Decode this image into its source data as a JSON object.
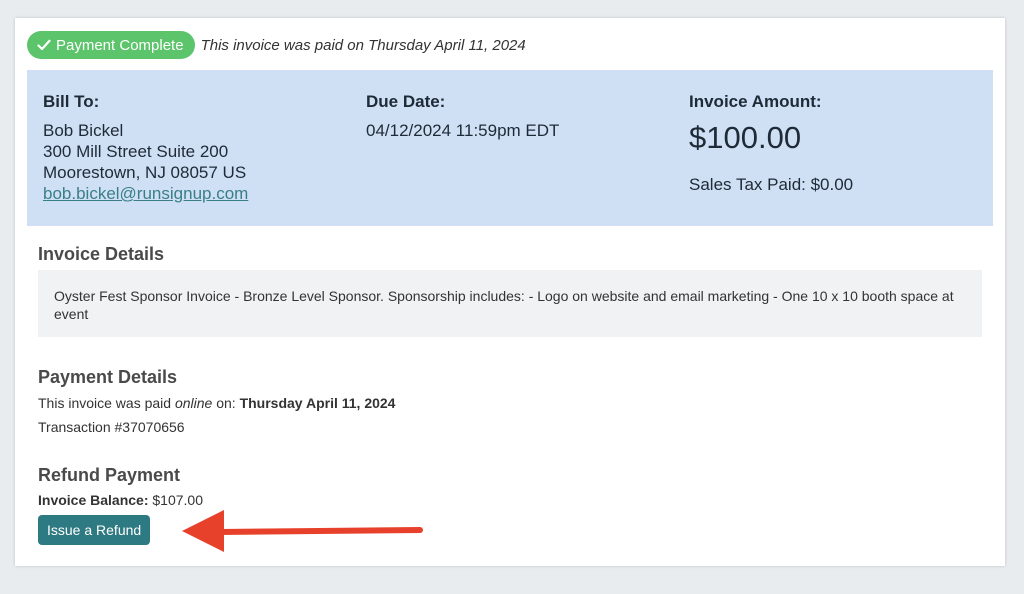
{
  "status": {
    "badge_label": "Payment Complete",
    "badge_icon": "check-icon",
    "badge_color": "#5cc46b",
    "paid_note": "This invoice was paid on Thursday April 11, 2024"
  },
  "bill_to": {
    "heading": "Bill To:",
    "name": "Bob Bickel",
    "address_line1": "300 Mill Street Suite 200",
    "address_line2": "Moorestown, NJ 08057 US",
    "email": "bob.bickel@runsignup.com"
  },
  "due_date": {
    "heading": "Due Date:",
    "value": "04/12/2024 11:59pm EDT"
  },
  "invoice_amount": {
    "heading": "Invoice Amount:",
    "value": "$100.00",
    "sales_tax": "Sales Tax Paid: $0.00"
  },
  "invoice_details": {
    "title": "Invoice Details",
    "description": "Oyster Fest Sponsor Invoice - Bronze Level Sponsor. Sponsorship includes: - Logo on website and email marketing - One 10 x 10 booth space at event"
  },
  "payment_details": {
    "title": "Payment Details",
    "paid_prefix": "This invoice was paid ",
    "paid_method": "online",
    "paid_on": " on: ",
    "paid_date": "Thursday April 11, 2024",
    "transaction": "Transaction #37070656"
  },
  "refund": {
    "title": "Refund Payment",
    "balance_label": "Invoice Balance:",
    "balance_value": " $107.00",
    "button_label": "Issue a Refund",
    "button_color": "#2e7a82"
  },
  "colors": {
    "panel_bg": "#cfe0f5",
    "arrow": "#e8412b"
  }
}
